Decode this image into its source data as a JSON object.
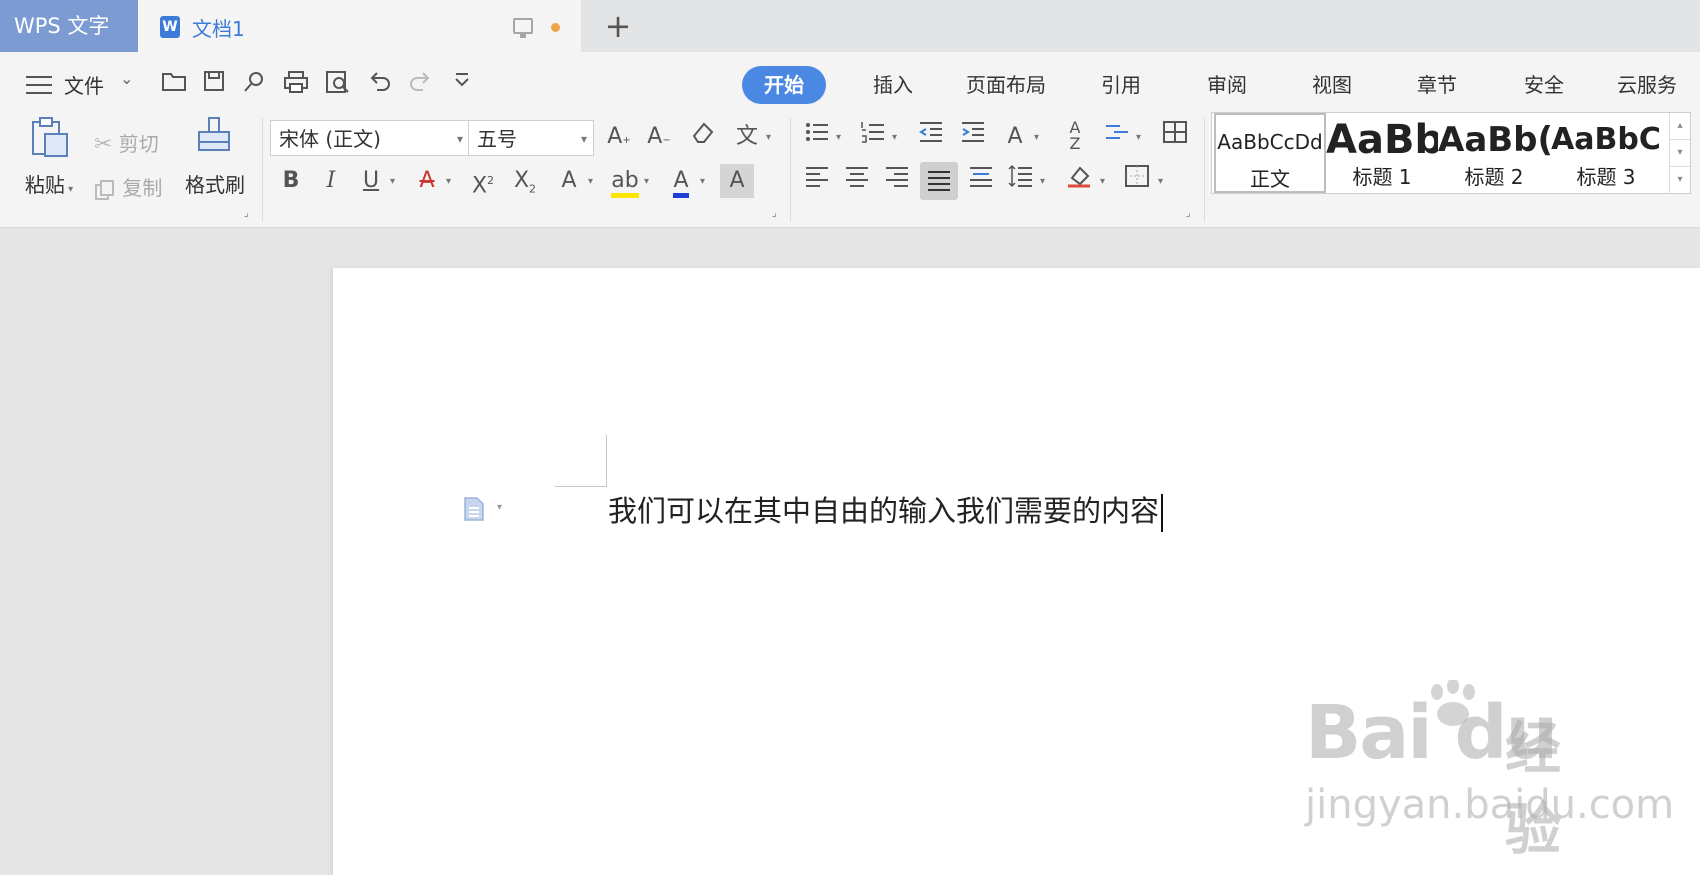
{
  "tabbar": {
    "app_tab": "WPS 文字",
    "doc_tab": {
      "icon": "W",
      "name": "文档1"
    },
    "add": "+"
  },
  "toolbar": {
    "file_label": "文件",
    "menu_tabs": [
      "开始",
      "插入",
      "页面布局",
      "引用",
      "审阅",
      "视图",
      "章节",
      "安全",
      "云服务"
    ]
  },
  "clipboard": {
    "paste_label": "粘贴",
    "cut_label": "剪切",
    "copy_label": "复制",
    "format_painter_label": "格式刷"
  },
  "font": {
    "family": "宋体 (正文)",
    "size": "五号"
  },
  "styles": [
    {
      "preview": "AaBbCcDd",
      "label": "正文"
    },
    {
      "preview": "AaBb",
      "label": "标题 1"
    },
    {
      "preview": "AaBb(",
      "label": "标题 2"
    },
    {
      "preview": "AaBbC",
      "label": "标题 3"
    }
  ],
  "document": {
    "text": "我们可以在其中自由的输入我们需要的内容"
  },
  "watermark": {
    "logo": "Bai du",
    "cn": "经验",
    "url": "jingyan.baidu.com"
  },
  "colors": {
    "accent": "#4b88e3",
    "app_tab": "#7d9bd3",
    "unsaved_dot": "#f0a44c",
    "highlight_yellow": "#ffe400",
    "font_color_blue": "#1f3fd6"
  }
}
